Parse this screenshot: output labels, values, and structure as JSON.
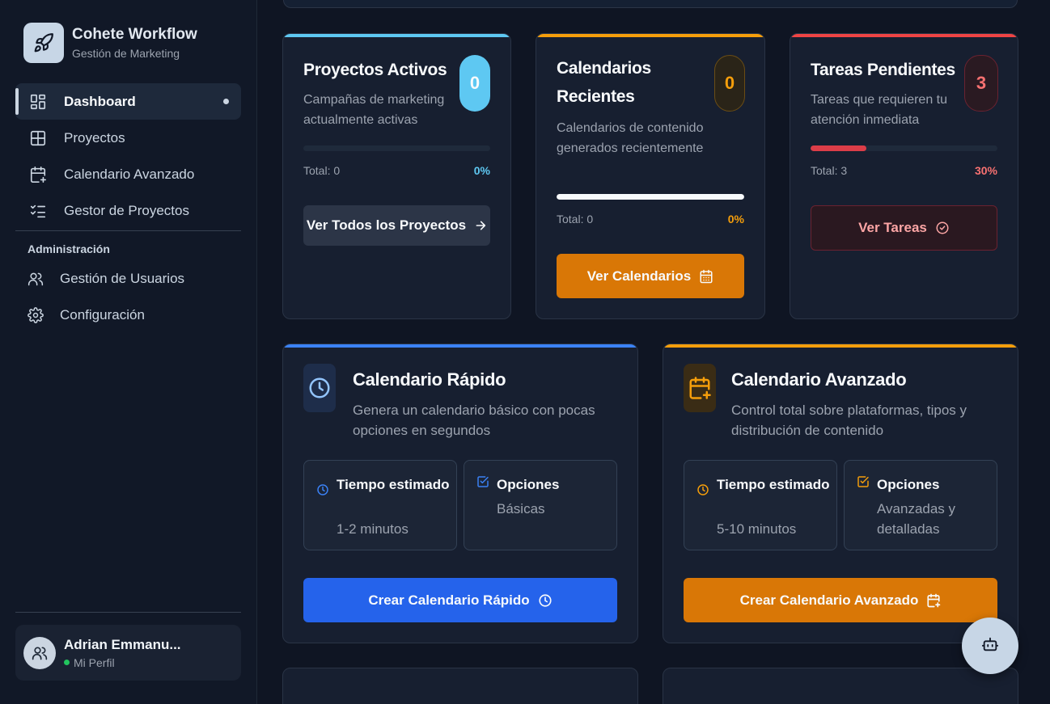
{
  "brand": {
    "title": "Cohete Workflow",
    "subtitle": "Gestión de Marketing"
  },
  "sidebar": {
    "items": [
      {
        "label": "Dashboard",
        "icon": "dashboard-icon"
      },
      {
        "label": "Proyectos",
        "icon": "grid-icon"
      },
      {
        "label": "Calendario Avanzado",
        "icon": "calendar-plus-icon"
      },
      {
        "label": "Gestor de Proyectos",
        "icon": "checklist-icon"
      }
    ],
    "admin_section": "Administración",
    "admin_items": [
      {
        "label": "Gestión de Usuarios",
        "icon": "users-icon"
      },
      {
        "label": "Configuración",
        "icon": "gear-icon"
      }
    ]
  },
  "profile": {
    "name": "Adrian Emmanu...",
    "status": "Mi Perfil"
  },
  "stats": {
    "projects": {
      "title": "Proyectos Activos",
      "count": "0",
      "desc": "Campañas de marketing actualmente activas",
      "total": "Total: 0",
      "pct": "0%",
      "progress": 0,
      "button": "Ver Todos los Proyectos",
      "accent": "#5ec8f2"
    },
    "calendars": {
      "title": "Calendarios Recientes",
      "count": "0",
      "desc": "Calendarios de contenido generados recientemente",
      "total": "Total: 0",
      "pct": "0%",
      "progress": 1,
      "button": "Ver Calendarios",
      "accent": "#f59e0b"
    },
    "tasks": {
      "title": "Tareas Pendientes",
      "count": "3",
      "desc": "Tareas que requieren tu atención inmediata",
      "total": "Total: 3",
      "pct": "30%",
      "progress": 0.3,
      "button": "Ver Tareas",
      "accent": "#ef4444"
    }
  },
  "quick": {
    "title": "Calendario Rápido",
    "desc": "Genera un calendario básico con pocas opciones en segundos",
    "time_label": "Tiempo estimado",
    "time_value": "1-2 minutos",
    "options_label": "Opciones",
    "options_value": "Básicas",
    "button": "Crear Calendario Rápido",
    "accent": "#3b82f6"
  },
  "advanced": {
    "title": "Calendario Avanzado",
    "desc": "Control total sobre plataformas, tipos y distribución de contenido",
    "time_label": "Tiempo estimado",
    "time_value": "5-10 minutos",
    "options_label": "Opciones",
    "options_value": "Avanzadas y detalladas",
    "button": "Crear Calendario Avanzado",
    "accent": "#f59e0b"
  },
  "fab": {
    "icon": "bot-icon"
  }
}
